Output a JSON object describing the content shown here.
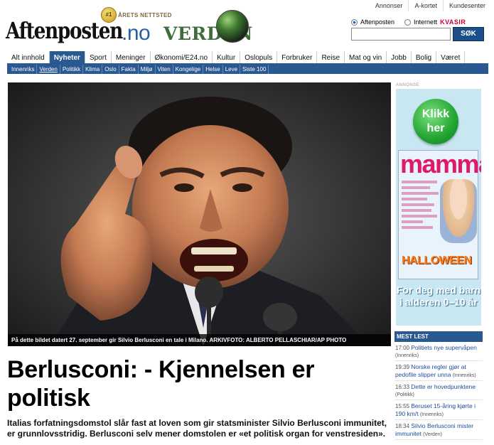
{
  "header": {
    "util_links": [
      "Annonser",
      "A-kortet",
      "Kundesenter"
    ],
    "logo": {
      "badge_text": "ÅRETS NETTSTED",
      "badge_number": "#1",
      "name": "Aftenposten",
      "tld": ".no",
      "section": "VERDEN"
    },
    "search": {
      "options": [
        "Aftenposten",
        "Internett"
      ],
      "selected": "Aftenposten",
      "provider": "KVASIR",
      "value": "",
      "button_label": "SØK"
    }
  },
  "nav": {
    "tabs": [
      {
        "label": "Alt innhold",
        "active": false
      },
      {
        "label": "Nyheter",
        "active": true
      },
      {
        "label": "Sport",
        "active": false
      },
      {
        "label": "Meninger",
        "active": false
      },
      {
        "label": "Økonomi/E24.no",
        "active": false
      },
      {
        "label": "Kultur",
        "active": false
      },
      {
        "label": "Oslopuls",
        "active": false
      },
      {
        "label": "Forbruker",
        "active": false
      },
      {
        "label": "Reise",
        "active": false
      },
      {
        "label": "Mat og vin",
        "active": false
      },
      {
        "label": "Jobb",
        "active": false
      },
      {
        "label": "Bolig",
        "active": false
      },
      {
        "label": "Været",
        "active": false
      }
    ],
    "subtabs": [
      {
        "label": "Innenriks",
        "active": false
      },
      {
        "label": "Verden",
        "active": true
      },
      {
        "label": "Politikk",
        "active": false
      },
      {
        "label": "Klima",
        "active": false
      },
      {
        "label": "Oslo",
        "active": false
      },
      {
        "label": "Fakta",
        "active": false
      },
      {
        "label": "Miljø",
        "active": false
      },
      {
        "label": "Viten",
        "active": false
      },
      {
        "label": "Kongelige",
        "active": false
      },
      {
        "label": "Helse",
        "active": false
      },
      {
        "label": "Leve",
        "active": false
      },
      {
        "label": "Siste 100",
        "active": false
      }
    ]
  },
  "article": {
    "photo_caption": "På dette bildet datert 27. september gir Silvio Berlusconi en tale i Milano. ARKIVFOTO: ALBERTO PELLASCHIAR/AP PHOTO",
    "headline": "Berlusconi: - Kjennelsen er politisk",
    "lead": "Italias forfatningsdomstol slår fast at loven som gir statsminister Silvio Berlusconi immunitet, er grunnlovsstridig. Berlusconi selv mener domstolen er «et politisk organ for venstresiden»."
  },
  "ad": {
    "label": "ANNONSE",
    "cta": "Klikk her",
    "magazine": "mamma",
    "cover_text": "HALLOWEEN",
    "tagline": "For deg med barn i alderen 0–10 år"
  },
  "most_read": {
    "title": "MEST LEST",
    "items": [
      {
        "time": "17:00",
        "title": "Politiets nye supervåpen",
        "category": "(Innenriks)"
      },
      {
        "time": "19:39",
        "title": "Norske regler gjør at pedofile slipper unna",
        "category": "(Innenriks)"
      },
      {
        "time": "16:33",
        "title": "Dette er hovedpunktene",
        "category": "(Politikk)"
      },
      {
        "time": "15:55",
        "title": "Beruset 15-åring kjørte i 190 km/t",
        "category": "(Innenriks)"
      },
      {
        "time": "18:34",
        "title": "Silvio Berlusconi mister immunitet",
        "category": "(Verden)"
      }
    ]
  },
  "colors": {
    "nav_blue": "#2a5891",
    "link_blue": "#1d4f9b",
    "ad_pink": "#e0186c",
    "ad_green": "#21a432"
  }
}
